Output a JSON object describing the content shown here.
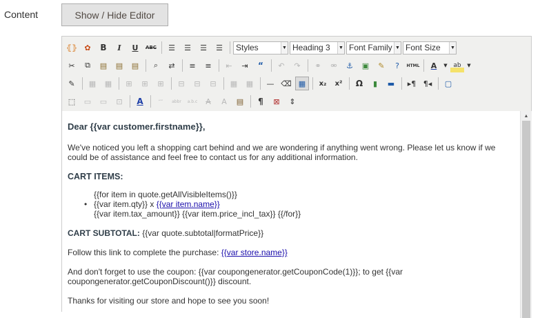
{
  "field": {
    "label": "Content"
  },
  "toggle": {
    "label": "Show / Hide Editor"
  },
  "toolbar": {
    "styles": "Styles",
    "format": "Heading 3",
    "font_family": "Font Family",
    "font_size": "Font Size",
    "html_label": "HTML"
  },
  "email": {
    "greeting": "Dear {{var customer.firstname}},",
    "intro": "We've noticed you left a shopping cart behind and we are wondering if anything went wrong. Please let us know if we could be of assistance and feel free to contact us for any additional information.",
    "cart_items_title": "CART ITEMS:",
    "loop_start": "{{for item in quote.getAllVisibleItems()}}",
    "item_qty": "{{var item.qty}} x ",
    "item_name": "{{var item.name}}",
    "item_prices": "{{var item.tax_amount}} {{var item.price_incl_tax}} {{/for}}",
    "subtotal_title": "CART SUBTOTAL:",
    "subtotal_value": " {{var quote.subtotal|formatPrice}}",
    "follow_text": "Follow this link to complete the purchase: ",
    "store_link": "{{var store.name}}",
    "coupon_text": "And don't forget to use the coupon: {{var coupongenerator.getCouponCode(1)}}; to get {{var coupongenerator.getCouponDiscount()}} discount.",
    "thanks": "Thanks for visiting our store and hope to see you soon!"
  }
}
